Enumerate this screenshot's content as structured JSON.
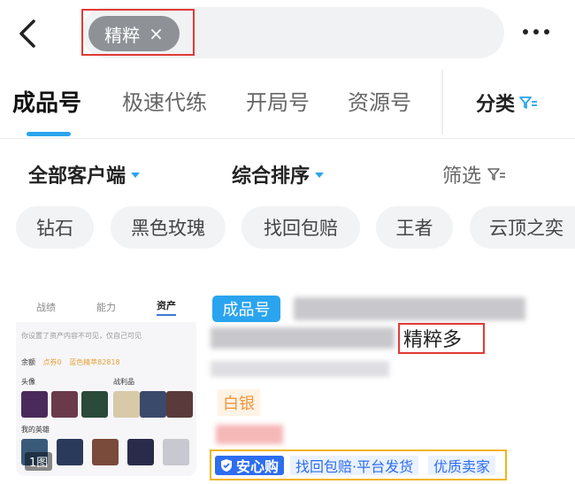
{
  "header": {
    "search_tag": "精粹",
    "search_tag_close": "×"
  },
  "tabs": [
    {
      "label": "成品号",
      "active": true
    },
    {
      "label": "极速代练",
      "active": false
    },
    {
      "label": "开局号",
      "active": false
    },
    {
      "label": "资源号",
      "active": false
    }
  ],
  "category_label": "分类",
  "filters": {
    "client": "全部客户端",
    "sort": "综合排序",
    "filter": "筛选"
  },
  "chips": [
    "钻石",
    "黑色玫瑰",
    "找回包赔",
    "王者",
    "云顶之奕"
  ],
  "listing": {
    "thumb_tabs": [
      "战绩",
      "能力",
      "资产"
    ],
    "thumb_note": "你设置了资产内容不可见，仅自己可见",
    "thumb_balance_label": "余额",
    "thumb_balance_points": "点券0",
    "thumb_balance_gold": "蓝色精萃82818",
    "thumb_avatar_label": "头像",
    "thumb_trophy_label": "战利品",
    "thumb_hero_label": "我的英雄",
    "image_count": "1图",
    "type_badge": "成品号",
    "highlight_text": "精粹多",
    "rank": "白银",
    "assurance_label": "安心购",
    "assurance_detail": "找回包赔·平台发货",
    "seller_label": "优质卖家"
  },
  "colors": {
    "accent": "#2aa4ee",
    "highlight_box": "#e23a35",
    "promo_box": "#f3b418",
    "rank": "#f0963b"
  }
}
